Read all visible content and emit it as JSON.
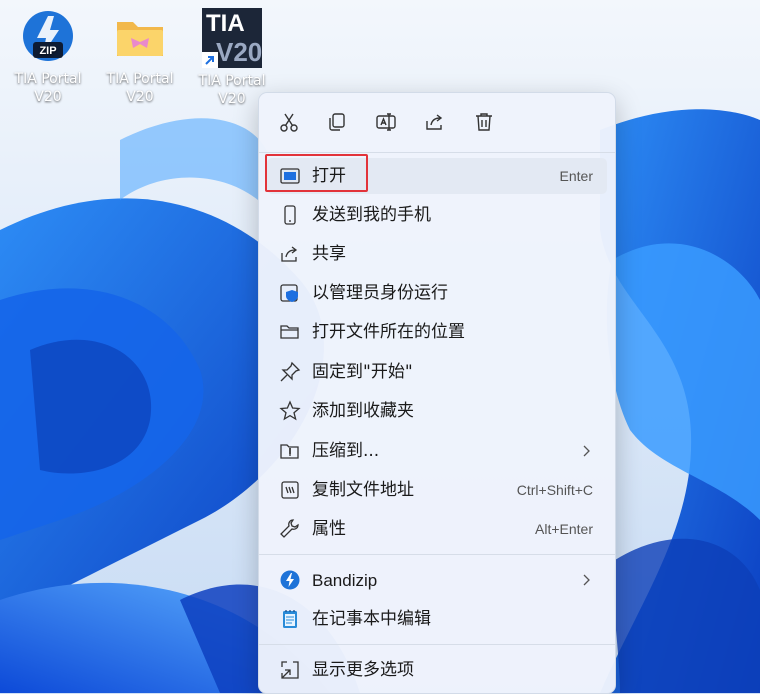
{
  "desktop": {
    "icons": [
      {
        "label": "TIA Portal\nV20",
        "icon": "zip-archive-icon"
      },
      {
        "label": "TIA Portal\nV20",
        "icon": "folder-icon"
      },
      {
        "label": "TIA Portal\nV20",
        "icon": "tia-shortcut-icon",
        "logo_line1": "TIA",
        "logo_line2": "V20"
      }
    ]
  },
  "context_menu": {
    "toolbar": [
      {
        "icon": "cut-icon"
      },
      {
        "icon": "copy-icon"
      },
      {
        "icon": "rename-icon"
      },
      {
        "icon": "share-icon"
      },
      {
        "icon": "delete-icon"
      }
    ],
    "items": [
      {
        "label": "打开",
        "shortcut": "Enter",
        "icon": "open-app-icon",
        "highlighted": true
      },
      {
        "label": "发送到我的手机",
        "icon": "phone-icon"
      },
      {
        "label": "共享",
        "icon": "share-icon"
      },
      {
        "label": "以管理员身份运行",
        "icon": "admin-shield-icon"
      },
      {
        "label": "打开文件所在的位置",
        "icon": "folder-open-icon"
      },
      {
        "label": "固定到\"开始\"",
        "icon": "pin-icon"
      },
      {
        "label": "添加到收藏夹",
        "icon": "star-icon"
      },
      {
        "label": "压缩到...",
        "icon": "compress-folder-icon",
        "submenu": true
      },
      {
        "label": "复制文件地址",
        "shortcut": "Ctrl+Shift+C",
        "icon": "copy-path-icon"
      },
      {
        "label": "属性",
        "shortcut": "Alt+Enter",
        "icon": "wrench-icon"
      },
      {
        "label": "Bandizip",
        "icon": "bandizip-icon",
        "submenu": true
      },
      {
        "label": "在记事本中编辑",
        "icon": "notepad-icon"
      },
      {
        "label": "显示更多选项",
        "icon": "more-options-icon"
      }
    ]
  },
  "colors": {
    "accent": "#1d6fe0",
    "highlight_box": "#e2333a"
  }
}
